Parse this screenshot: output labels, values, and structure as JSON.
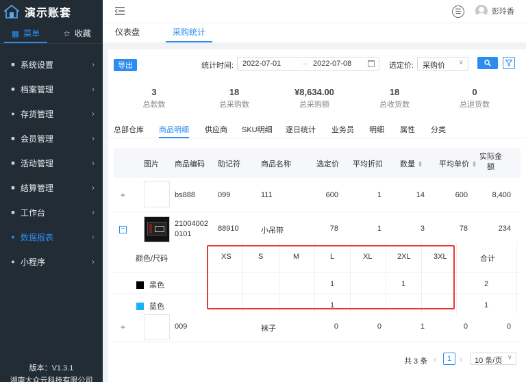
{
  "app": {
    "name": "演示账套"
  },
  "side_tabs": {
    "menu": "菜单",
    "favorites": "收藏"
  },
  "sidebar": {
    "items": [
      {
        "label": "系统设置"
      },
      {
        "label": "档案管理"
      },
      {
        "label": "存货管理"
      },
      {
        "label": "会员管理"
      },
      {
        "label": "活动管理"
      },
      {
        "label": "结算管理"
      },
      {
        "label": "工作台"
      },
      {
        "label": "数据报表"
      },
      {
        "label": "小程序"
      }
    ],
    "version": "版本：V1.3.1",
    "company": "湖南大众云科技有限公司"
  },
  "header": {
    "user_name": "彭玲香"
  },
  "nav_tabs": [
    {
      "label": "仪表盘"
    },
    {
      "label": "采购统计"
    }
  ],
  "toolbar": {
    "export_label": "导出",
    "time_label": "统计时间:",
    "date_start": "2022-07-01",
    "date_arrow": "→",
    "date_end": "2022-07-08",
    "price_label": "选定价:",
    "price_value": "采购价"
  },
  "stats": [
    {
      "value": "3",
      "label": "总款数"
    },
    {
      "value": "18",
      "label": "总采购数"
    },
    {
      "value": "¥8,634.00",
      "label": "总采购额"
    },
    {
      "value": "18",
      "label": "总收货数"
    },
    {
      "value": "0",
      "label": "总退货数"
    }
  ],
  "sub_tabs": [
    {
      "label": "总部仓库"
    },
    {
      "label": "商品明细"
    },
    {
      "label": "供应商"
    },
    {
      "label": "SKU明细"
    },
    {
      "label": "逐日统计"
    },
    {
      "label": "业务员"
    },
    {
      "label": "明细"
    },
    {
      "label": "属性"
    },
    {
      "label": "分类"
    }
  ],
  "table": {
    "headers": {
      "image": "图片",
      "code": "商品编码",
      "mnemonic": "助记符",
      "name": "商品名称",
      "price": "选定价",
      "discount": "平均折扣",
      "qty": "数量",
      "unit_price": "平均单价",
      "amount_line1": "实际金",
      "amount_line2": "额"
    },
    "rows": [
      {
        "expander": "+",
        "code": "bs888",
        "code2": "",
        "mnemonic": "099",
        "name": "111",
        "price": "600",
        "discount": "1",
        "qty": "14",
        "unit_price": "600",
        "amount": "8,400"
      },
      {
        "expander": "−",
        "code": "21004002",
        "code2": "0101",
        "mnemonic": "88910",
        "name": "小吊带",
        "price": "78",
        "discount": "1",
        "qty": "3",
        "unit_price": "78",
        "amount": "234"
      },
      {
        "expander": "+",
        "code": "009",
        "code2": "",
        "mnemonic": "",
        "name": "袜子",
        "price": "0",
        "discount": "0",
        "qty": "1",
        "unit_price": "0",
        "amount": "0"
      }
    ]
  },
  "size_grid": {
    "corner": "颜色/尺码",
    "sizes": [
      "XS",
      "S",
      "M",
      "L",
      "XL",
      "2XL",
      "3XL"
    ],
    "total_label": "合计",
    "colors": [
      {
        "name": "黑色",
        "swatch": "#000000",
        "values": [
          "",
          "",
          "",
          "1",
          "",
          "1",
          ""
        ],
        "total": "2"
      },
      {
        "name": "蓝色",
        "swatch": "#1ab3f5",
        "values": [
          "",
          "",
          "",
          "1",
          "",
          "",
          ""
        ],
        "total": "1"
      }
    ]
  },
  "pagination": {
    "total": "共 3 条",
    "current": "1",
    "page_size": "10 条/页"
  },
  "colors": {
    "accent": "#2d8cf0",
    "sidebar_bg": "#222c35",
    "highlight": "#e53935"
  }
}
